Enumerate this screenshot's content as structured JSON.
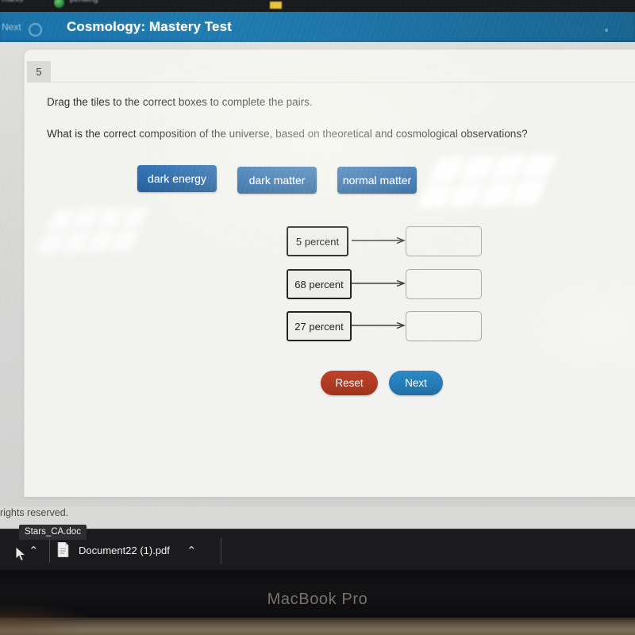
{
  "browser_chrome": {
    "left_text": "marks",
    "tab_text": "pending",
    "icons": [
      "green-circle-icon",
      "yellow-highlight-icon"
    ]
  },
  "app_header": {
    "back_label": "Next",
    "timer_icon": "clock-icon",
    "title": "Cosmology: Mastery Test"
  },
  "question": {
    "number": "5",
    "instruction": "Drag the tiles to the correct boxes to complete the pairs.",
    "prompt": "What is the correct composition of the universe, based on theoretical and cosmological observations?"
  },
  "tiles": [
    {
      "label": "dark energy"
    },
    {
      "label": "dark matter"
    },
    {
      "label": "normal matter"
    }
  ],
  "pairs": [
    {
      "label": "5 percent",
      "drop_value": ""
    },
    {
      "label": "68 percent",
      "drop_value": ""
    },
    {
      "label": "27 percent",
      "drop_value": ""
    }
  ],
  "buttons": {
    "reset_label": "Reset",
    "next_label": "Next"
  },
  "footer": {
    "copyright_fragment": "rights reserved."
  },
  "taskbar": {
    "tooltip": "Stars_CA.doc",
    "download_file": "Document22 (1).pdf",
    "chevron_glyph": "⌃"
  },
  "device": {
    "brand": "MacBook Pro"
  },
  "colors": {
    "header_blue": "#1d6fa3",
    "tile_blue": "#1b5fad",
    "reset_red": "#b03a24",
    "next_blue": "#2479b5",
    "card_bg": "#f2f2f0",
    "page_bg": "#d7d8d6",
    "taskbar_bg": "#1b1b1d"
  }
}
